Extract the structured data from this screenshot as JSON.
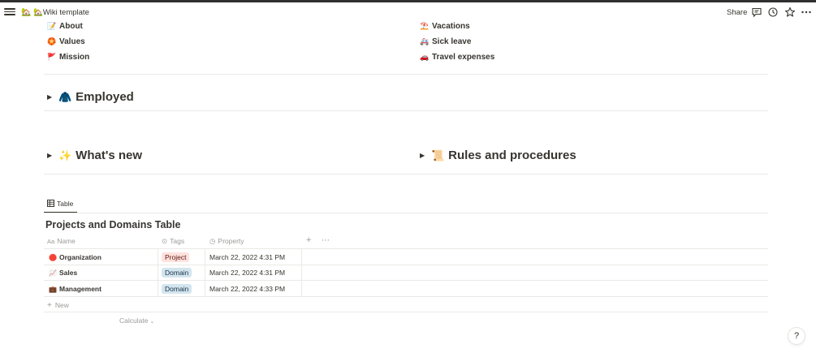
{
  "topbar": {
    "page_title": "Wiki template",
    "share_label": "Share",
    "icons": [
      "menu-icon",
      "home-icon",
      "comment-icon",
      "clock-icon",
      "star-icon",
      "more-icon"
    ]
  },
  "links_left": [
    {
      "icon": "📝",
      "label": "About"
    },
    {
      "icon": "🏵️",
      "label": "Values"
    },
    {
      "icon": "🚩",
      "label": "Mission"
    }
  ],
  "links_right": [
    {
      "icon": "⛱️",
      "label": "Vacations"
    },
    {
      "icon": "🚑",
      "label": "Sick leave"
    },
    {
      "icon": "🚗",
      "label": "Travel expenses"
    }
  ],
  "toggles": {
    "employed": {
      "emoji": "🧥",
      "label": "Employed"
    },
    "whats_new": {
      "emoji": "✨",
      "label": "What's new"
    },
    "rules": {
      "emoji": "📜",
      "label": "Rules and procedures"
    }
  },
  "database": {
    "view_tab": "Table",
    "title": "Projects and Domains Table",
    "columns": {
      "name": "Name",
      "tags": "Tags",
      "property": "Property"
    },
    "rows": [
      {
        "icon": "🛑",
        "name": "Organization",
        "tag": "Project",
        "date": "March 22, 2022 4:31 PM"
      },
      {
        "icon": "📈",
        "name": "Sales",
        "tag": "Domain",
        "date": "March 22, 2022 4:31 PM"
      },
      {
        "icon": "💼",
        "name": "Management",
        "tag": "Domain",
        "date": "March 22, 2022 4:33 PM"
      }
    ],
    "new_label": "New",
    "calculate_label": "Calculate"
  },
  "help_label": "?",
  "colors": {
    "tag_project_bg": "#ffe2dd",
    "tag_domain_bg": "#d3e5ef",
    "text": "#37352f",
    "muted": "#9b9a97"
  }
}
